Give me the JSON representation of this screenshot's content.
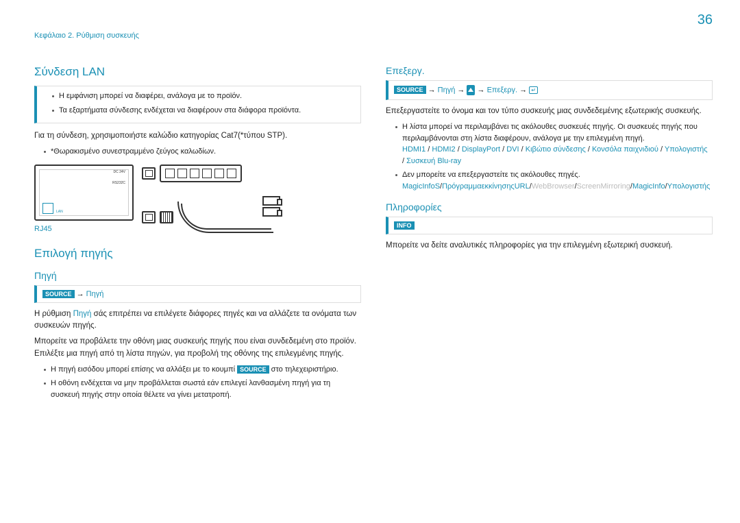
{
  "page_number": "36",
  "breadcrumb": "Κεφάλαιο 2. Ρύθμιση συσκευής",
  "left": {
    "lan_title": "Σύνδεση LAN",
    "note1_li1": "Η εμφάνιση μπορεί να διαφέρει, ανάλογα με το προϊόν.",
    "note1_li2": "Τα εξαρτήματα σύνδεσης ενδέχεται να διαφέρουν στα διάφορα προϊόντα.",
    "p1": "Για τη σύνδεση, χρησιμοποιήστε καλώδιο κατηγορίας Cat7(*τύπου STP).",
    "p1_li": "*Θωρακισμένο συνεστραμμένο ζεύγος καλωδίων.",
    "rj45": "RJ45",
    "epilogi_title": "Επιλογή πηγής",
    "pigi_title": "Πηγή",
    "source_badge": "SOURCE",
    "pigi_link": "Πηγή",
    "p2a": "Η ρύθμιση ",
    "p2b": " σάς επιτρέπει να επιλέγετε διάφορες πηγές και να αλλάζετε τα ονόματα των συσκευών πηγής.",
    "p3": "Μπορείτε να προβάλετε την οθόνη μιας συσκευής πηγής που είναι συνδεδεμένη στο προϊόν. Επιλέξτε μια πηγή από τη λίστα πηγών, για προβολή της οθόνης της επιλεγμένης πηγής.",
    "li3a": "Η πηγή εισόδου μπορεί επίσης να αλλάξει με το κουμπί ",
    "li3b": " στο τηλεχειριστήριο.",
    "li4": "Η οθόνη ενδέχεται να μην προβάλλεται σωστά εάν επιλεγεί λανθασμένη πηγή για τη συσκευή πηγής στην οποία θέλετε να γίνει μετατροπή."
  },
  "right": {
    "epex_title": "Επεξεργ.",
    "source_badge": "SOURCE",
    "nav_pigi": "Πηγή",
    "nav_epex": "Επεξεργ.",
    "p4": "Επεξεργαστείτε το όνομα και τον τύπο συσκευής μιας συνδεδεμένης εξωτερικής συσκευής.",
    "li5": "Η λίστα μπορεί να περιλαμβάνει τις ακόλουθες συσκευές πηγής. Οι συσκευές πηγής που περιλαμβάνονται στη λίστα διαφέρουν, ανάλογα με την επιλεγμένη πηγή.",
    "src_hdmi1": "HDMI1",
    "src_hdmi2": "HDMI2",
    "src_dp": "DisplayPort",
    "src_dvi": "DVI",
    "src_box": "Κιβώτιο σύνδεσης",
    "src_game": "Κονσόλα παιχνιδιού",
    "src_pc": "Υπολογιστής",
    "src_bluray": "Συσκευή Blu-ray",
    "li6": "Δεν μπορείτε να επεξεργαστείτε τις ακόλουθες πηγές.",
    "src_magicinfos": "MagicInfoS",
    "src_urlboot": "ΠρόγραμμαεκκίνησηςURL",
    "src_webbrowser": "WebBrowser",
    "src_mirror": "ScreenMirroring",
    "src_magicinfo": "MagicInfo",
    "src_pc2": "Υπολογιστής",
    "info_title": "Πληροφορίες",
    "info_badge": "INFO",
    "p5": "Μπορείτε να δείτε αναλυτικές πληροφορίες για την επιλεγμένη εξωτερική συσκευή."
  }
}
